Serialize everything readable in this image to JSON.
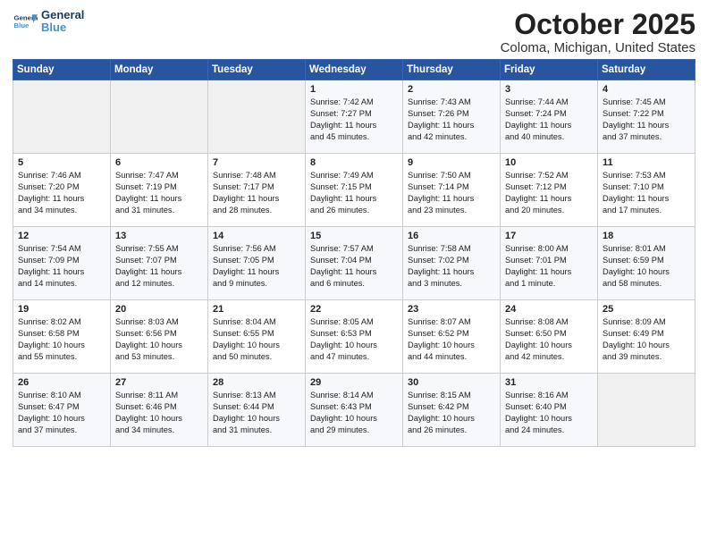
{
  "header": {
    "logo_line1": "General",
    "logo_line2": "Blue",
    "month": "October 2025",
    "location": "Coloma, Michigan, United States"
  },
  "weekdays": [
    "Sunday",
    "Monday",
    "Tuesday",
    "Wednesday",
    "Thursday",
    "Friday",
    "Saturday"
  ],
  "weeks": [
    [
      {
        "day": "",
        "info": ""
      },
      {
        "day": "",
        "info": ""
      },
      {
        "day": "",
        "info": ""
      },
      {
        "day": "1",
        "info": "Sunrise: 7:42 AM\nSunset: 7:27 PM\nDaylight: 11 hours\nand 45 minutes."
      },
      {
        "day": "2",
        "info": "Sunrise: 7:43 AM\nSunset: 7:26 PM\nDaylight: 11 hours\nand 42 minutes."
      },
      {
        "day": "3",
        "info": "Sunrise: 7:44 AM\nSunset: 7:24 PM\nDaylight: 11 hours\nand 40 minutes."
      },
      {
        "day": "4",
        "info": "Sunrise: 7:45 AM\nSunset: 7:22 PM\nDaylight: 11 hours\nand 37 minutes."
      }
    ],
    [
      {
        "day": "5",
        "info": "Sunrise: 7:46 AM\nSunset: 7:20 PM\nDaylight: 11 hours\nand 34 minutes."
      },
      {
        "day": "6",
        "info": "Sunrise: 7:47 AM\nSunset: 7:19 PM\nDaylight: 11 hours\nand 31 minutes."
      },
      {
        "day": "7",
        "info": "Sunrise: 7:48 AM\nSunset: 7:17 PM\nDaylight: 11 hours\nand 28 minutes."
      },
      {
        "day": "8",
        "info": "Sunrise: 7:49 AM\nSunset: 7:15 PM\nDaylight: 11 hours\nand 26 minutes."
      },
      {
        "day": "9",
        "info": "Sunrise: 7:50 AM\nSunset: 7:14 PM\nDaylight: 11 hours\nand 23 minutes."
      },
      {
        "day": "10",
        "info": "Sunrise: 7:52 AM\nSunset: 7:12 PM\nDaylight: 11 hours\nand 20 minutes."
      },
      {
        "day": "11",
        "info": "Sunrise: 7:53 AM\nSunset: 7:10 PM\nDaylight: 11 hours\nand 17 minutes."
      }
    ],
    [
      {
        "day": "12",
        "info": "Sunrise: 7:54 AM\nSunset: 7:09 PM\nDaylight: 11 hours\nand 14 minutes."
      },
      {
        "day": "13",
        "info": "Sunrise: 7:55 AM\nSunset: 7:07 PM\nDaylight: 11 hours\nand 12 minutes."
      },
      {
        "day": "14",
        "info": "Sunrise: 7:56 AM\nSunset: 7:05 PM\nDaylight: 11 hours\nand 9 minutes."
      },
      {
        "day": "15",
        "info": "Sunrise: 7:57 AM\nSunset: 7:04 PM\nDaylight: 11 hours\nand 6 minutes."
      },
      {
        "day": "16",
        "info": "Sunrise: 7:58 AM\nSunset: 7:02 PM\nDaylight: 11 hours\nand 3 minutes."
      },
      {
        "day": "17",
        "info": "Sunrise: 8:00 AM\nSunset: 7:01 PM\nDaylight: 11 hours\nand 1 minute."
      },
      {
        "day": "18",
        "info": "Sunrise: 8:01 AM\nSunset: 6:59 PM\nDaylight: 10 hours\nand 58 minutes."
      }
    ],
    [
      {
        "day": "19",
        "info": "Sunrise: 8:02 AM\nSunset: 6:58 PM\nDaylight: 10 hours\nand 55 minutes."
      },
      {
        "day": "20",
        "info": "Sunrise: 8:03 AM\nSunset: 6:56 PM\nDaylight: 10 hours\nand 53 minutes."
      },
      {
        "day": "21",
        "info": "Sunrise: 8:04 AM\nSunset: 6:55 PM\nDaylight: 10 hours\nand 50 minutes."
      },
      {
        "day": "22",
        "info": "Sunrise: 8:05 AM\nSunset: 6:53 PM\nDaylight: 10 hours\nand 47 minutes."
      },
      {
        "day": "23",
        "info": "Sunrise: 8:07 AM\nSunset: 6:52 PM\nDaylight: 10 hours\nand 44 minutes."
      },
      {
        "day": "24",
        "info": "Sunrise: 8:08 AM\nSunset: 6:50 PM\nDaylight: 10 hours\nand 42 minutes."
      },
      {
        "day": "25",
        "info": "Sunrise: 8:09 AM\nSunset: 6:49 PM\nDaylight: 10 hours\nand 39 minutes."
      }
    ],
    [
      {
        "day": "26",
        "info": "Sunrise: 8:10 AM\nSunset: 6:47 PM\nDaylight: 10 hours\nand 37 minutes."
      },
      {
        "day": "27",
        "info": "Sunrise: 8:11 AM\nSunset: 6:46 PM\nDaylight: 10 hours\nand 34 minutes."
      },
      {
        "day": "28",
        "info": "Sunrise: 8:13 AM\nSunset: 6:44 PM\nDaylight: 10 hours\nand 31 minutes."
      },
      {
        "day": "29",
        "info": "Sunrise: 8:14 AM\nSunset: 6:43 PM\nDaylight: 10 hours\nand 29 minutes."
      },
      {
        "day": "30",
        "info": "Sunrise: 8:15 AM\nSunset: 6:42 PM\nDaylight: 10 hours\nand 26 minutes."
      },
      {
        "day": "31",
        "info": "Sunrise: 8:16 AM\nSunset: 6:40 PM\nDaylight: 10 hours\nand 24 minutes."
      },
      {
        "day": "",
        "info": ""
      }
    ]
  ]
}
